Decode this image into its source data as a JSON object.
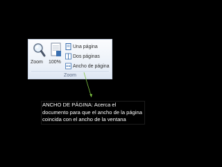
{
  "ribbon": {
    "zoom_label": "Zoom",
    "percent_label": "100%",
    "options": [
      {
        "label": "Una página",
        "icon": "one-page-icon"
      },
      {
        "label": "Dos páginas",
        "icon": "two-pages-icon"
      },
      {
        "label": "Ancho de página",
        "icon": "page-width-icon"
      }
    ],
    "group_label": "Zoom"
  },
  "caption": {
    "text": "ANCHO DE PÁGINA: Acerca el documento para que el ancho de la página coincida con el ancho de la ventana"
  },
  "colors": {
    "background": "#000000",
    "arrow": "#7dc242",
    "caption_text": "#ffffff"
  },
  "icons": {
    "zoom": "magnifier-icon",
    "percent": "page-100-icon"
  }
}
